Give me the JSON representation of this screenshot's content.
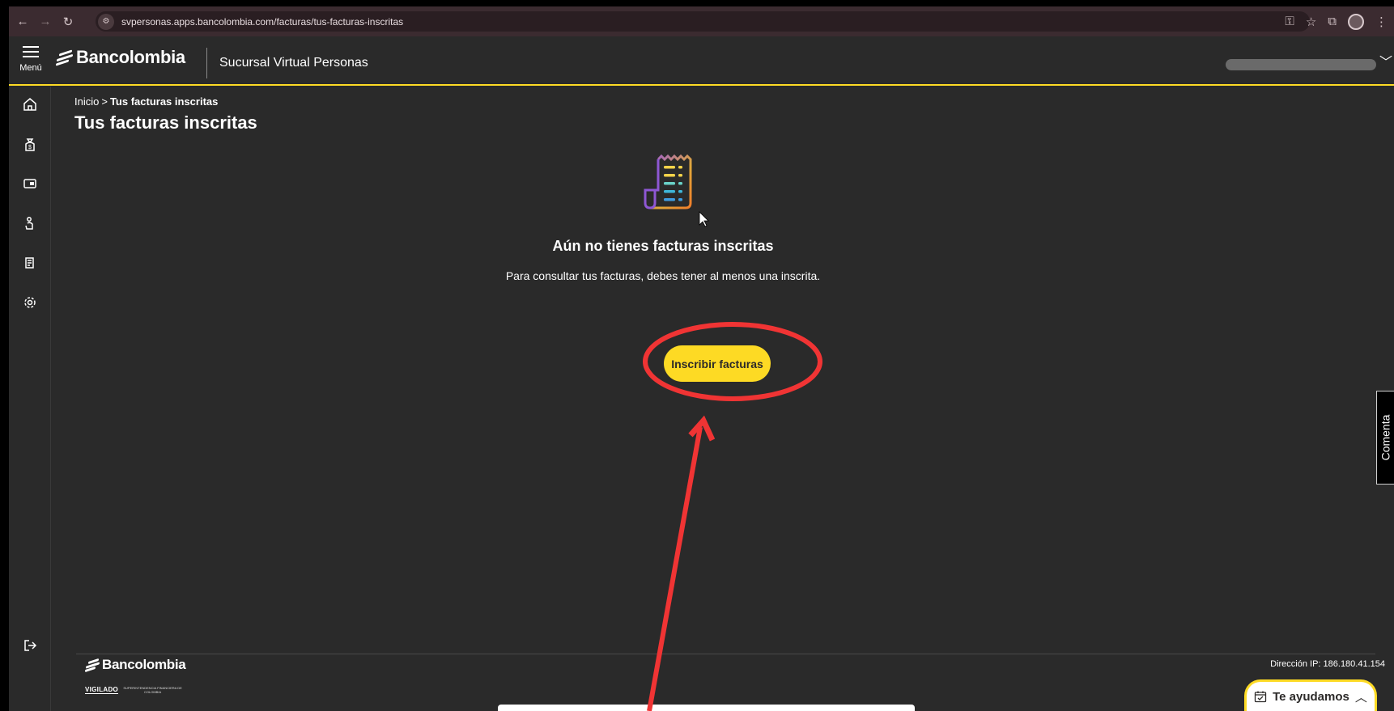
{
  "browser": {
    "url": "svpersonas.apps.bancolombia.com/facturas/tus-facturas-inscritas"
  },
  "header": {
    "menu_label": "Menú",
    "brand": "Bancolombia",
    "subtitle": "Sucursal Virtual Personas"
  },
  "breadcrumb": {
    "home": "Inicio",
    "separator": ">",
    "current": "Tus facturas inscritas"
  },
  "page": {
    "title": "Tus facturas inscritas",
    "empty_title": "Aún no tienes facturas inscritas",
    "empty_text": "Para consultar tus facturas, debes tener al menos una inscrita.",
    "cta_label": "Inscribir facturas"
  },
  "feedback": {
    "label": "Comenta"
  },
  "footer": {
    "brand": "Bancolombia",
    "vigilado": "VIGILADO",
    "vigilado_sub": "SUPERINTENDENCIA FINANCIERA DE COLOMBIA",
    "ip": "Dirección IP: 186.180.41.154",
    "help_label": "Te ayudamos"
  },
  "colors": {
    "brand_yellow": "#fdda24",
    "background": "#2a2a2a",
    "annotation_red": "#f03434"
  },
  "icons": {
    "sidebar": [
      "home-icon",
      "money-bag-icon",
      "card-icon",
      "touch-icon",
      "bill-icon",
      "gear-icon",
      "logout-icon"
    ]
  }
}
